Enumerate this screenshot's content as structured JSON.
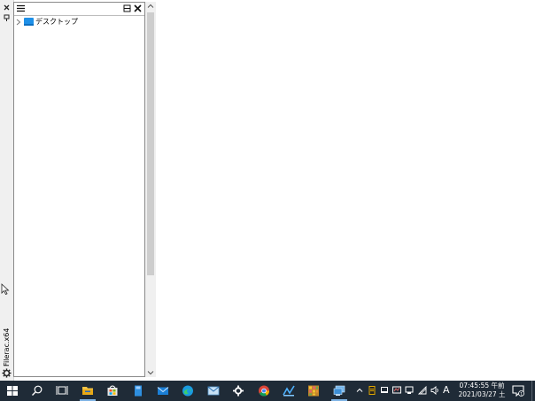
{
  "leftbar": {
    "label": "Filerac.x64"
  },
  "pane": {
    "tree": [
      {
        "label": "デスクトップ"
      }
    ]
  },
  "taskbar": {
    "apps": [
      {
        "name": "start"
      },
      {
        "name": "search"
      },
      {
        "name": "task-view"
      },
      {
        "name": "file-explorer"
      },
      {
        "name": "store"
      },
      {
        "name": "notebook"
      },
      {
        "name": "mail"
      },
      {
        "name": "edge"
      },
      {
        "name": "mail-app"
      },
      {
        "name": "settings"
      },
      {
        "name": "chrome"
      },
      {
        "name": "app-1"
      },
      {
        "name": "app-2"
      },
      {
        "name": "remote-desktop"
      }
    ],
    "ime": "A",
    "time": "07:45:55 午前",
    "date": "2021/03/27 土",
    "colors": {
      "bg": "#1f2b37",
      "accent": "#7fb4e6"
    }
  }
}
